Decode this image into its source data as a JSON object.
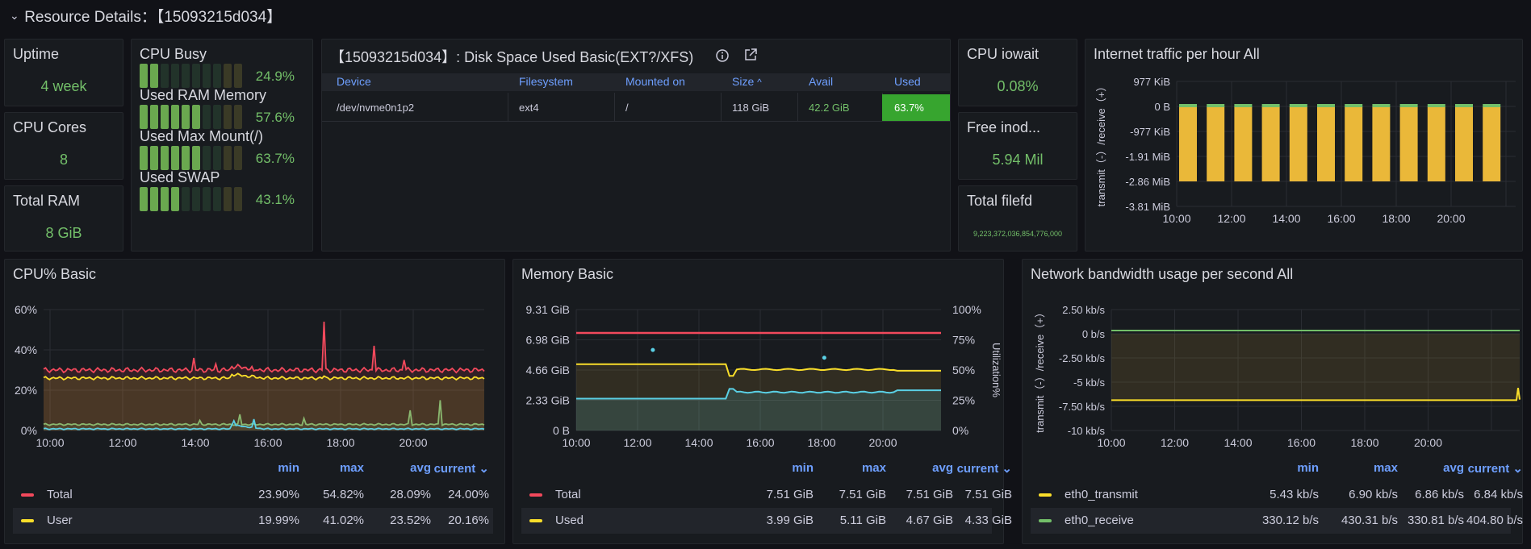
{
  "header": {
    "chevron": "⌄",
    "title": "Resource Details：【15093215d034】"
  },
  "stats": {
    "uptime": {
      "label": "Uptime",
      "value": "4 week"
    },
    "cpu_cores": {
      "label": "CPU Cores",
      "value": "8"
    },
    "total_ram": {
      "label": "Total RAM",
      "value": "8 GiB"
    },
    "cpu_iowait": {
      "label": "CPU iowait",
      "value": "0.08%"
    },
    "free_inodes": {
      "label": "Free inod...",
      "value": "5.94 Mil"
    },
    "total_filefd": {
      "label": "Total filefd",
      "value": "9,223,372,036,854,776,000"
    }
  },
  "gauges": [
    {
      "label": "CPU Busy",
      "value": "24.9%",
      "fraction": 0.249
    },
    {
      "label": "Used RAM Memory",
      "value": "57.6%",
      "fraction": 0.576
    },
    {
      "label": "Used Max Mount(/)",
      "value": "63.7%",
      "fraction": 0.637
    },
    {
      "label": "Used SWAP",
      "value": "43.1%",
      "fraction": 0.431
    }
  ],
  "disk_panel": {
    "title": "【15093215d034】: Disk Space Used Basic(EXT?/XFS)",
    "info_icon": "info-icon",
    "link_icon": "external-link-icon",
    "columns": [
      "Device",
      "Filesystem",
      "Mounted on",
      "Size",
      "Avail",
      "Used"
    ],
    "sort_indicator": "^",
    "row": {
      "device": "/dev/nvme0n1p2",
      "filesystem": "ext4",
      "mounted": "/",
      "size": "118 GiB",
      "avail": "42.2 GiB",
      "used": "63.7%"
    }
  },
  "traffic_panel": {
    "title": "Internet traffic per hour All",
    "ylabel": "transmit（-）/receive（+）",
    "yticks": [
      "977 KiB",
      "0 B",
      "-977 KiB",
      "-1.91 MiB",
      "-2.86 MiB",
      "-3.81 MiB"
    ],
    "xticks": [
      "10:00",
      "12:00",
      "14:00",
      "16:00",
      "18:00",
      "20:00"
    ]
  },
  "cpu_panel": {
    "title": "CPU% Basic",
    "yticks": [
      "60%",
      "40%",
      "20%",
      "0%"
    ],
    "xticks": [
      "10:00",
      "12:00",
      "14:00",
      "16:00",
      "18:00",
      "20:00"
    ],
    "legend_headers": [
      "min",
      "max",
      "avg",
      "current"
    ],
    "legend": [
      {
        "name": "Total",
        "color": "#f2495c",
        "min": "23.90%",
        "max": "54.82%",
        "avg": "28.09%",
        "current": "24.00%"
      },
      {
        "name": "User",
        "color": "#fade2a",
        "min": "19.99%",
        "max": "41.02%",
        "avg": "23.52%",
        "current": "20.16%"
      }
    ]
  },
  "mem_panel": {
    "title": "Memory Basic",
    "yticks": [
      "9.31 GiB",
      "6.98 GiB",
      "4.66 GiB",
      "2.33 GiB",
      "0 B"
    ],
    "yticks_right": [
      "100%",
      "75%",
      "50%",
      "25%",
      "0%"
    ],
    "ylabel_right": "Utilization%",
    "xticks": [
      "10:00",
      "12:00",
      "14:00",
      "16:00",
      "18:00",
      "20:00"
    ],
    "legend_headers": [
      "min",
      "max",
      "avg",
      "current"
    ],
    "legend": [
      {
        "name": "Total",
        "color": "#f2495c",
        "min": "7.51 GiB",
        "max": "7.51 GiB",
        "avg": "7.51 GiB",
        "current": "7.51 GiB"
      },
      {
        "name": "Used",
        "color": "#fade2a",
        "min": "3.99 GiB",
        "max": "5.11 GiB",
        "avg": "4.67 GiB",
        "current": "4.33 GiB"
      }
    ]
  },
  "net_panel": {
    "title": "Network bandwidth usage per second All",
    "ylabel": "transmit（-）/receive（+）",
    "yticks": [
      "2.50 kb/s",
      "0 b/s",
      "-2.50 kb/s",
      "-5 kb/s",
      "-7.50 kb/s",
      "-10 kb/s"
    ],
    "xticks": [
      "10:00",
      "12:00",
      "14:00",
      "16:00",
      "18:00",
      "20:00"
    ],
    "legend_headers": [
      "min",
      "max",
      "avg",
      "current"
    ],
    "legend": [
      {
        "name": "eth0_transmit",
        "color": "#fade2a",
        "min": "5.43 kb/s",
        "max": "6.90 kb/s",
        "avg": "6.86 kb/s",
        "current": "6.84 kb/s"
      },
      {
        "name": "eth0_receive",
        "color": "#73bf69",
        "min": "330.12 b/s",
        "max": "430.31 b/s",
        "avg": "330.81 b/s",
        "current": "404.80 b/s"
      }
    ]
  },
  "colors": {
    "green": "#73bf69",
    "yellow": "#eab839",
    "red": "#f2495c",
    "blue": "#6e9fff",
    "cyan": "#5ad0e5",
    "panel": "#181b1f",
    "bg": "#111217"
  }
}
